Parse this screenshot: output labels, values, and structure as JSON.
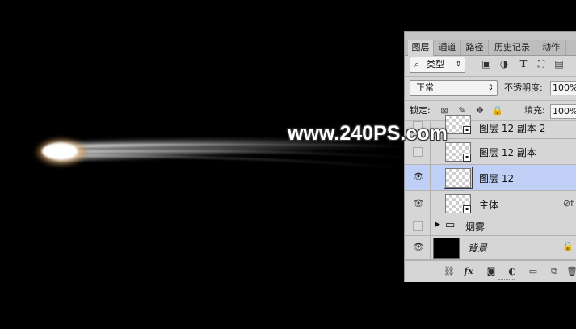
{
  "watermark": "www.240PS.com",
  "panel": {
    "tabs": [
      "图层",
      "通道",
      "路径",
      "历史记录",
      "动作"
    ],
    "filter": {
      "kind_label": "类型",
      "search_icon": "search-icon",
      "arrow": "⌃⌄"
    },
    "filter_icons": [
      "image-filter-icon",
      "adjustment-filter-icon",
      "type-filter-icon",
      "shape-filter-icon",
      "smart-object-filter-icon"
    ],
    "blend_mode": "正常",
    "opacity_label": "不透明度:",
    "opacity_value": "100%",
    "lock_label": "锁定:",
    "lock_icons": [
      "lock-transparent-icon",
      "lock-paint-icon",
      "lock-move-icon",
      "lock-all-icon"
    ],
    "fill_label": "填充:",
    "fill_value": "100%",
    "layers": [
      {
        "name": "图层 12 副本 2",
        "visible": false,
        "selected": false,
        "thumb": "smart"
      },
      {
        "name": "图层 12 副本",
        "visible": false,
        "selected": false,
        "thumb": "smart"
      },
      {
        "name": "图层 12",
        "visible": true,
        "selected": true,
        "thumb": "plain"
      },
      {
        "name": "主体",
        "visible": true,
        "selected": false,
        "thumb": "smart"
      },
      {
        "name": "烟雾",
        "visible": false,
        "selected": false,
        "thumb": "group"
      },
      {
        "name": "背景",
        "visible": true,
        "selected": false,
        "thumb": "black"
      }
    ],
    "bottom_icons": [
      "link-icon",
      "fx-icon",
      "mask-icon",
      "adjustment-icon",
      "folder-icon",
      "new-layer-icon",
      "trash-icon"
    ],
    "fx_label": "fx"
  },
  "colors": {
    "background": "#000000",
    "panel": "#d6d6d6",
    "selection": "#bfcff5"
  }
}
